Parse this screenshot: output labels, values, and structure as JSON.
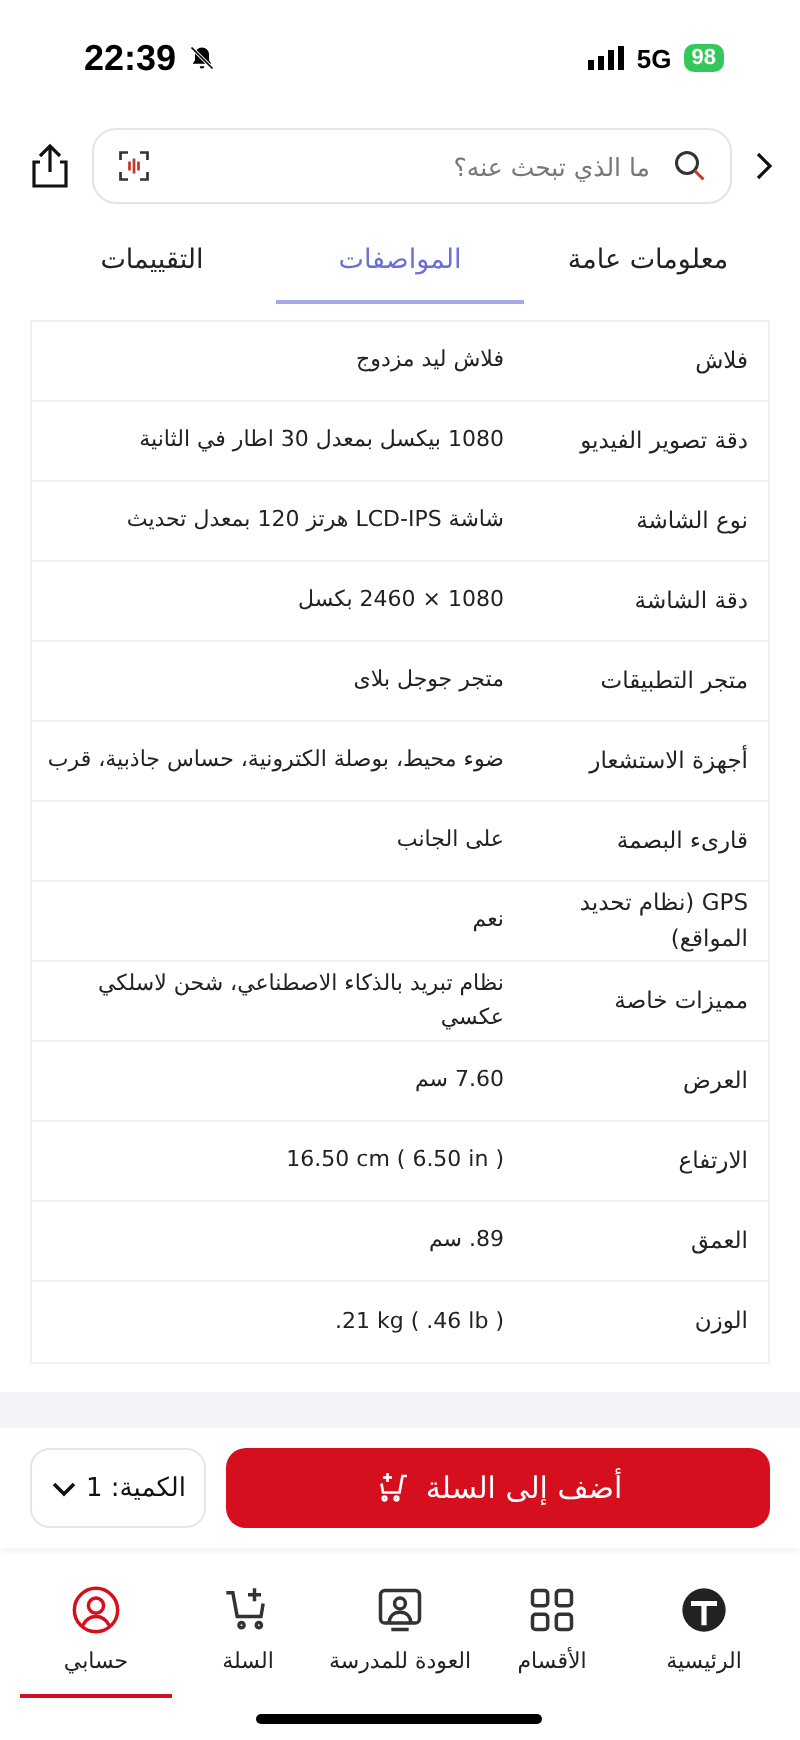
{
  "status_bar": {
    "time": "22:39",
    "network": "5G",
    "battery": "98"
  },
  "search": {
    "placeholder": "ما الذي تبحث عنه؟"
  },
  "tabs": [
    {
      "label": "معلومات عامة",
      "selected": false
    },
    {
      "label": "المواصفات",
      "selected": true
    },
    {
      "label": "التقييمات",
      "selected": false
    }
  ],
  "specs": [
    {
      "label": "فلاش",
      "value": "فلاش ليد مزدوج"
    },
    {
      "label": "دقة تصوير الفيديو",
      "value": "1080 بيكسل بمعدل 30 اطار في الثانية"
    },
    {
      "label": "نوع الشاشة",
      "value": "شاشة LCD-IPS هرتز 120 بمعدل تحديث"
    },
    {
      "label": "دقة الشاشة",
      "value": "1080 × 2460 بكسل"
    },
    {
      "label": "متجر التطبيقات",
      "value": "متجر جوجل بلاى"
    },
    {
      "label": "أجهزة الاستشعار",
      "value": "ضوء محيط، بوصلة الكترونية، حساس جاذبية، قرب"
    },
    {
      "label": "قارىء البصمة",
      "value": "على الجانب"
    },
    {
      "label": "GPS (نظام تحديد المواقع)",
      "value": "نعم"
    },
    {
      "label": "مميزات خاصة",
      "value": "نظام تبريد بالذكاء الاصطناعي، شحن لاسلكي عكسي"
    },
    {
      "label": "العرض",
      "value": "7.60 سم"
    },
    {
      "label": "الارتفاع",
      "value": "16.50 cm ( 6.50 in )"
    },
    {
      "label": "العمق",
      "value": "89. سم"
    },
    {
      "label": "الوزن",
      "value": ".21 kg ( .46 lb )"
    }
  ],
  "cart": {
    "add_button": "أضف إلى السلة",
    "quantity": "الكمية: 1"
  },
  "bottom_nav": [
    {
      "label": "الرئيسية",
      "kind": "home",
      "selected": false
    },
    {
      "label": "الأقسام",
      "kind": "grid",
      "selected": false
    },
    {
      "label": "العودة للمدرسة",
      "kind": "school",
      "selected": false
    },
    {
      "label": "السلة",
      "kind": "cart",
      "selected": false
    },
    {
      "label": "حسابي",
      "kind": "account",
      "selected": true
    }
  ]
}
